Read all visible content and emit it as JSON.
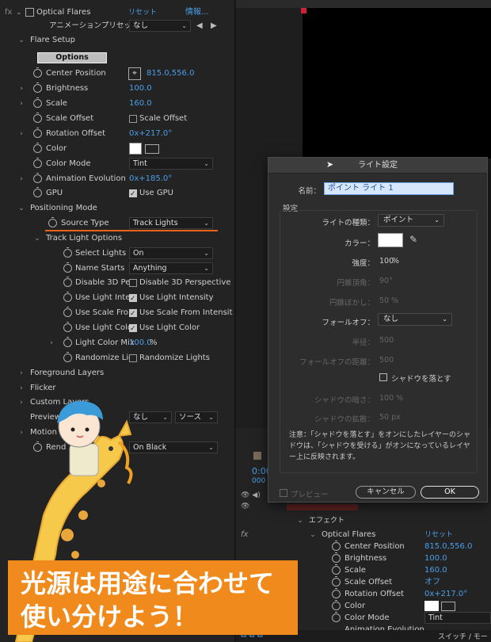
{
  "effect": {
    "fx": "fx",
    "name": "Optical Flares",
    "reset": "リセット",
    "info": "情報...",
    "preset_label": "アニメーションプリセット：",
    "preset_value": "なし",
    "group_flare_setup": "Flare Setup",
    "options_button": "Options",
    "center_position_label": "Center Position",
    "center_position_value": "815.0,556.0",
    "brightness_label": "Brightness",
    "brightness_value": "100.0",
    "scale_label": "Scale",
    "scale_value": "160.0",
    "scale_offset_label": "Scale Offset",
    "scale_offset_cb": "Scale Offset",
    "rotation_offset_label": "Rotation Offset",
    "rotation_offset_value": "0x+217.0°",
    "color_label": "Color",
    "color_mode_label": "Color Mode",
    "color_mode_value": "Tint",
    "anim_evolution_label": "Animation Evolution",
    "anim_evolution_value": "0x+185.0°",
    "gpu_label": "GPU",
    "gpu_cb": "Use GPU",
    "group_positioning": "Positioning Mode",
    "source_type_label": "Source Type",
    "source_type_value": "Track Lights",
    "group_track_light": "Track Light Options",
    "select_lights_label": "Select Lights",
    "select_lights_value": "On",
    "name_starts_label": "Name Starts",
    "name_starts_value": "Anything",
    "disable3d_label": "Disable 3D Per",
    "disable3d_cb": "Disable 3D Perspective",
    "use_intensity_label": "Use Light Inte",
    "use_intensity_cb": "Use Light Intensity",
    "use_scale_label": "Use Scale Fro",
    "use_scale_cb": "Use Scale From Intensit",
    "use_color_label": "Use Light Colo",
    "use_color_cb": "Use Light Color",
    "light_color_mix_label": "Light Color Mix",
    "light_color_mix_value": "100.0",
    "light_color_mix_unit": "%",
    "randomize_label": "Randomize Lig",
    "randomize_cb": "Randomize Lights",
    "group_foreground": "Foreground Layers",
    "group_flicker": "Flicker",
    "group_custom": "Custom Layers",
    "preview_label": "Preview",
    "preview_value1": "なし",
    "preview_value2": "ソース",
    "group_motion": "Motion",
    "render_label": "Rend",
    "render_value": "On Black"
  },
  "dialog": {
    "title": "ライト設定",
    "name_label": "名前：",
    "name_value": "ポイント ライト 1",
    "settings": "設定",
    "light_type_label": "ライトの種類：",
    "light_type_value": "ポイント",
    "color_label": "カラー：",
    "intensity_label": "強度：",
    "intensity_value": "100",
    "intensity_unit": "%",
    "cone_angle_label": "円錐頂角：",
    "cone_angle_value": "90°",
    "cone_feather_label": "円錐ぼかし：",
    "cone_feather_value": "50 %",
    "falloff_label": "フォールオフ：",
    "falloff_value": "なし",
    "radius_label": "半径：",
    "radius_value": "500",
    "falloff_dist_label": "フォールオフの距離：",
    "falloff_dist_value": "500",
    "cast_shadows": "シャドウを落とす",
    "shadow_darkness_label": "シャドウの暗さ：",
    "shadow_darkness_value": "100 %",
    "shadow_diffusion_label": "シャドウの拡散：",
    "shadow_diffusion_value": "50 px",
    "note": "注意：「シャドウを落とす」をオンにしたレイヤーのシャドウは、「シャドウを受ける」がオンになっているレイヤー上に反映されます。",
    "preview": "プレビュー",
    "cancel": "キャンセル",
    "ok": "OK"
  },
  "timeline": {
    "time_partial": "0:00",
    "time_partial2": "000",
    "effect_group": "エフェクト",
    "effect_name": "Optical Flares",
    "reset": "リセット",
    "center_position_label": "Center Position",
    "center_position_value": "815.0,556.0",
    "brightness_label": "Brightness",
    "brightness_value": "100.0",
    "scale_label": "Scale",
    "scale_value": "160.0",
    "scale_offset_label": "Scale Offset",
    "scale_offset_value": "オフ",
    "rotation_offset_label": "Rotation Offset",
    "rotation_offset_value": "0x+217.0°",
    "color_label": "Color",
    "color_mode_label": "Color Mode",
    "color_mode_value": "Tint",
    "anim_evolution_partial": "Animation Evolution",
    "fx": "fx",
    "switch_mode": "スイッチ / モード"
  },
  "banner": {
    "line1": "光源は用途に合わせて",
    "line2": "使い分けよう！"
  },
  "colors": {
    "accent_blue": "#4a9fe8",
    "banner_orange": "#f08a1c",
    "underline_orange": "#e8641c"
  }
}
